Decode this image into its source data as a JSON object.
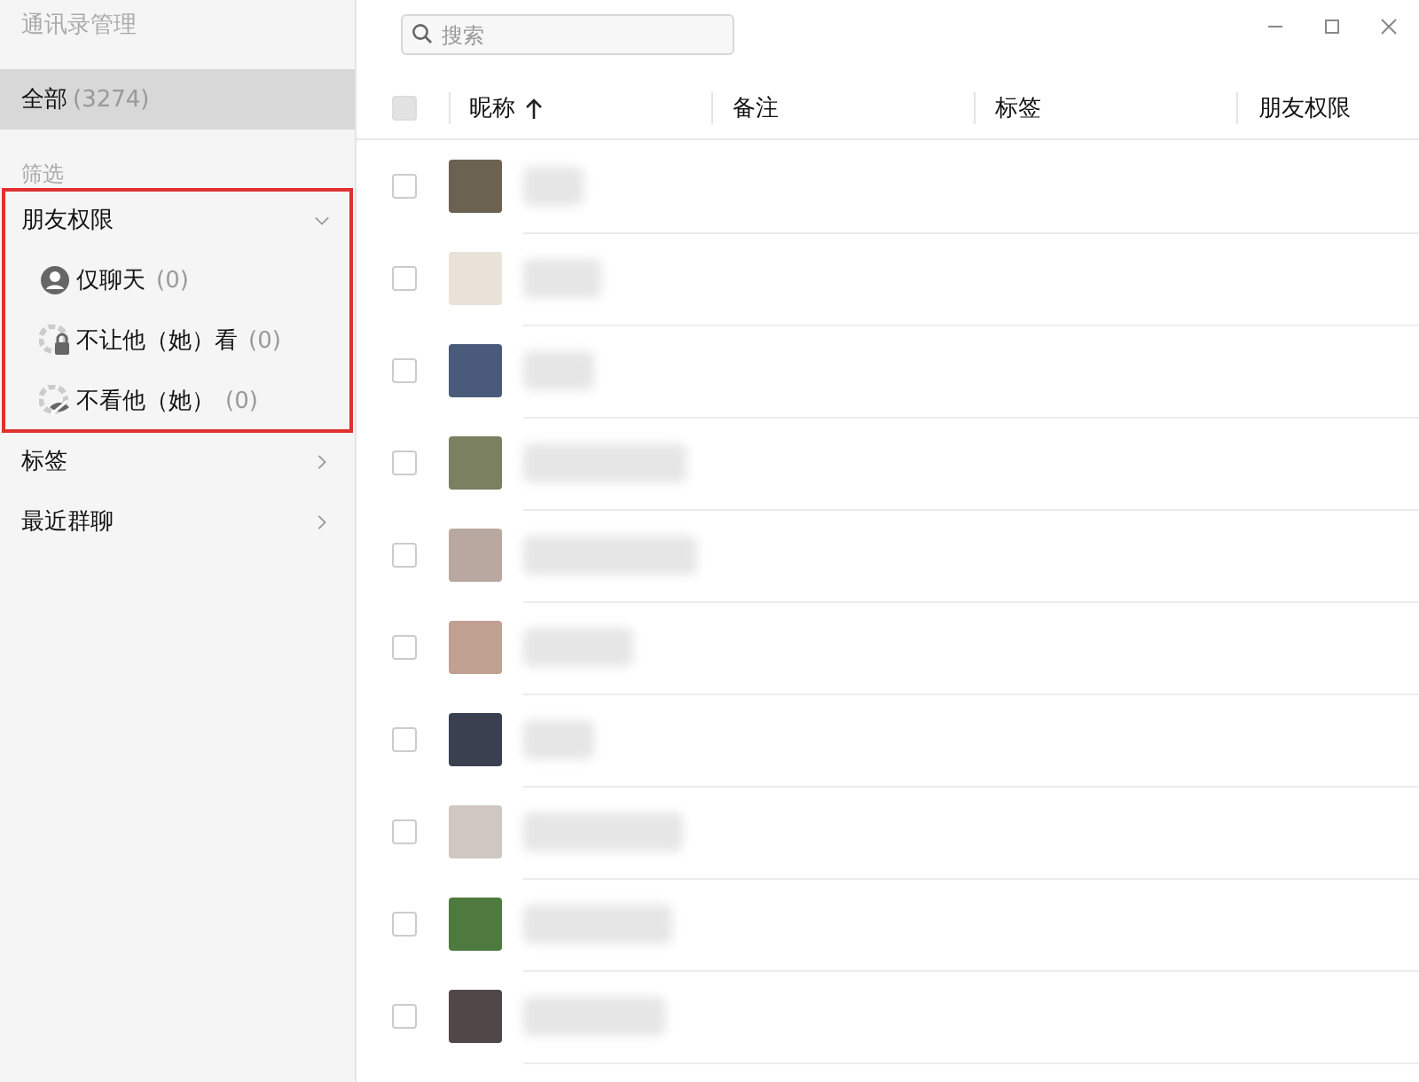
{
  "window": {
    "title": "通讯录管理"
  },
  "sidebar": {
    "all": {
      "label": "全部",
      "count": "(3274)",
      "selected": true
    },
    "filter_heading": "筛选",
    "groups": [
      {
        "label": "朋友权限",
        "expanded": true,
        "highlighted": true,
        "children": [
          {
            "kind": "chat-only",
            "label": "仅聊天",
            "count": "(0)"
          },
          {
            "kind": "hide-mine",
            "label": "不让他（她）看",
            "count": "(0)"
          },
          {
            "kind": "hide-theirs",
            "label": "不看他（她）",
            "count": "(0)"
          }
        ]
      },
      {
        "label": "标签",
        "expanded": false,
        "highlighted": false
      },
      {
        "label": "最近群聊",
        "expanded": false,
        "highlighted": false
      }
    ]
  },
  "search": {
    "placeholder": "搜索"
  },
  "table": {
    "select_all": {
      "checked": false
    },
    "columns": [
      {
        "label": "昵称",
        "sorted": true
      },
      {
        "label": "备注",
        "sorted": false
      },
      {
        "label": "标签",
        "sorted": false
      },
      {
        "label": "朋友权限",
        "sorted": false
      }
    ],
    "rows": [
      {
        "checked": false
      },
      {
        "checked": false
      },
      {
        "checked": false
      },
      {
        "checked": false
      },
      {
        "checked": false
      },
      {
        "checked": false
      },
      {
        "checked": false
      },
      {
        "checked": false
      },
      {
        "checked": false
      },
      {
        "checked": false
      }
    ]
  }
}
